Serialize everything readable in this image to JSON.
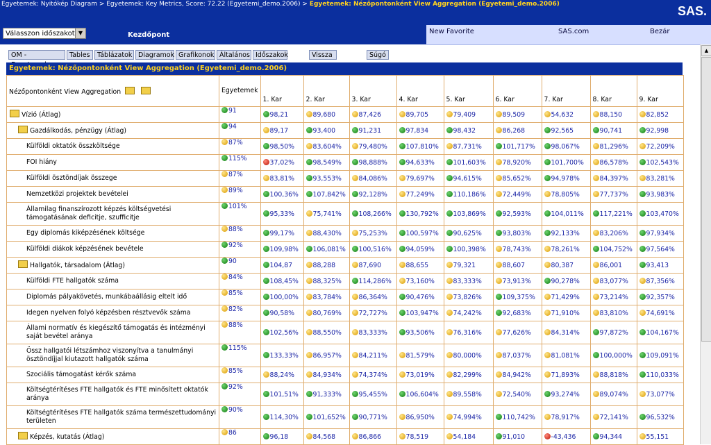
{
  "breadcrumb": {
    "items": [
      "Egyetemek: Nyitókép Diagram",
      "Egyetemek: Key Metrics, Score: 72.22 (Egyetemi_demo.2006)"
    ],
    "separator": " > ",
    "current": "Egyetemek: Nézőpontonként View Aggregation (Egyetemi_demo.2006)"
  },
  "logo": "SAS.",
  "period_select": "Válasszon időszakot",
  "start_label": "Kezdőpont",
  "nav": {
    "new_favorite": "New Favorite",
    "sas_com": "SAS.com",
    "close": "Bezár"
  },
  "tabs": [
    "OM - Egyetemek",
    "Tables",
    "Táblázatok",
    "Diagramok",
    "Grafikonok",
    "Általános",
    "Időszakok",
    "Vissza",
    "Súgó"
  ],
  "panel_title": "Egyetemek: Nézőpontonként View Aggregation (Egyetemi_demo.2006)",
  "table": {
    "corner": "Nézőpontonként View Aggregation",
    "columns": [
      "Egyetemek",
      "1. Kar",
      "2. Kar",
      "3. Kar",
      "4. Kar",
      "5. Kar",
      "6. Kar",
      "7. Kar",
      "8. Kar",
      "9. Kar"
    ],
    "rows": [
      {
        "name": "Vízió (Átlag)",
        "level": 0,
        "cells": [
          [
            "91",
            "g"
          ],
          [
            "98,21",
            "g"
          ],
          [
            "89,680",
            "y"
          ],
          [
            "87,426",
            "y"
          ],
          [
            "89,705",
            "y"
          ],
          [
            "79,409",
            "y"
          ],
          [
            "89,509",
            "y"
          ],
          [
            "54,632",
            "y"
          ],
          [
            "88,150",
            "y"
          ],
          [
            "82,852",
            "y"
          ]
        ]
      },
      {
        "name": "Gazdálkodás, pénzügy (Átlag)",
        "level": 1,
        "cells": [
          [
            "94",
            "g"
          ],
          [
            "89,17",
            "y"
          ],
          [
            "93,400",
            "g"
          ],
          [
            "91,231",
            "g"
          ],
          [
            "97,834",
            "g"
          ],
          [
            "98,432",
            "g"
          ],
          [
            "86,268",
            "y"
          ],
          [
            "92,565",
            "g"
          ],
          [
            "90,741",
            "g"
          ],
          [
            "92,998",
            "g"
          ]
        ]
      },
      {
        "name": "Külföldi oktatók összköltsége",
        "level": 2,
        "cells": [
          [
            "87%",
            "y"
          ],
          [
            "98,50%",
            "g"
          ],
          [
            "83,604%",
            "y"
          ],
          [
            "79,480%",
            "y"
          ],
          [
            "107,810%",
            "g"
          ],
          [
            "87,731%",
            "y"
          ],
          [
            "101,717%",
            "g"
          ],
          [
            "98,067%",
            "g"
          ],
          [
            "81,296%",
            "y"
          ],
          [
            "72,209%",
            "y"
          ]
        ]
      },
      {
        "name": "FOI hiány",
        "level": 2,
        "cells": [
          [
            "115%",
            "g"
          ],
          [
            "37,02%",
            "r"
          ],
          [
            "98,549%",
            "g"
          ],
          [
            "98,888%",
            "g"
          ],
          [
            "94,633%",
            "g"
          ],
          [
            "101,603%",
            "g"
          ],
          [
            "78,920%",
            "y"
          ],
          [
            "101,700%",
            "g"
          ],
          [
            "86,578%",
            "y"
          ],
          [
            "102,543%",
            "g"
          ]
        ]
      },
      {
        "name": "Külföldi ösztöndíjak összege",
        "level": 2,
        "cells": [
          [
            "87%",
            "y"
          ],
          [
            "83,81%",
            "y"
          ],
          [
            "93,553%",
            "g"
          ],
          [
            "84,086%",
            "y"
          ],
          [
            "79,697%",
            "y"
          ],
          [
            "94,615%",
            "g"
          ],
          [
            "85,652%",
            "y"
          ],
          [
            "94,978%",
            "g"
          ],
          [
            "84,397%",
            "y"
          ],
          [
            "83,281%",
            "y"
          ]
        ]
      },
      {
        "name": "Nemzetközi projektek bevételei",
        "level": 2,
        "cells": [
          [
            "89%",
            "y"
          ],
          [
            "100,36%",
            "g"
          ],
          [
            "107,842%",
            "g"
          ],
          [
            "92,128%",
            "g"
          ],
          [
            "77,249%",
            "y"
          ],
          [
            "110,186%",
            "g"
          ],
          [
            "72,449%",
            "y"
          ],
          [
            "78,805%",
            "y"
          ],
          [
            "77,737%",
            "y"
          ],
          [
            "93,983%",
            "g"
          ]
        ]
      },
      {
        "name": "Államilag finanszírozott képzés költségvetési támogatásának deficitje, szufficitje",
        "level": 2,
        "tall": true,
        "cells": [
          [
            "101%",
            "g"
          ],
          [
            "95,33%",
            "g"
          ],
          [
            "75,741%",
            "y"
          ],
          [
            "108,266%",
            "g"
          ],
          [
            "130,792%",
            "g"
          ],
          [
            "103,869%",
            "g"
          ],
          [
            "92,593%",
            "g"
          ],
          [
            "104,011%",
            "g"
          ],
          [
            "117,221%",
            "g"
          ],
          [
            "103,470%",
            "g"
          ]
        ]
      },
      {
        "name": "Egy diplomás kiképzésének költsége",
        "level": 2,
        "cells": [
          [
            "88%",
            "y"
          ],
          [
            "99,17%",
            "g"
          ],
          [
            "88,430%",
            "y"
          ],
          [
            "75,253%",
            "y"
          ],
          [
            "100,597%",
            "g"
          ],
          [
            "90,625%",
            "g"
          ],
          [
            "93,803%",
            "g"
          ],
          [
            "92,133%",
            "g"
          ],
          [
            "83,206%",
            "y"
          ],
          [
            "97,934%",
            "g"
          ]
        ]
      },
      {
        "name": "Külföldi diákok képzésének bevétele",
        "level": 2,
        "cells": [
          [
            "92%",
            "g"
          ],
          [
            "109,98%",
            "g"
          ],
          [
            "106,081%",
            "g"
          ],
          [
            "100,516%",
            "g"
          ],
          [
            "94,059%",
            "g"
          ],
          [
            "100,398%",
            "g"
          ],
          [
            "78,743%",
            "y"
          ],
          [
            "78,261%",
            "y"
          ],
          [
            "104,752%",
            "g"
          ],
          [
            "97,564%",
            "g"
          ]
        ]
      },
      {
        "name": "Hallgatók, társadalom (Átlag)",
        "level": 1,
        "cells": [
          [
            "90",
            "g"
          ],
          [
            "104,87",
            "g"
          ],
          [
            "88,288",
            "y"
          ],
          [
            "87,690",
            "y"
          ],
          [
            "88,655",
            "y"
          ],
          [
            "79,321",
            "y"
          ],
          [
            "88,607",
            "y"
          ],
          [
            "80,387",
            "y"
          ],
          [
            "86,001",
            "y"
          ],
          [
            "93,413",
            "g"
          ]
        ]
      },
      {
        "name": "Külföldi FTE hallgatók száma",
        "level": 2,
        "cells": [
          [
            "84%",
            "y"
          ],
          [
            "108,45%",
            "g"
          ],
          [
            "88,325%",
            "y"
          ],
          [
            "114,286%",
            "g"
          ],
          [
            "73,160%",
            "y"
          ],
          [
            "83,333%",
            "y"
          ],
          [
            "73,913%",
            "y"
          ],
          [
            "90,278%",
            "g"
          ],
          [
            "83,077%",
            "y"
          ],
          [
            "87,356%",
            "y"
          ]
        ]
      },
      {
        "name": "Diplomás pályakövetés, munkábaállásig eltelt idő",
        "level": 2,
        "cells": [
          [
            "85%",
            "y"
          ],
          [
            "100,00%",
            "g"
          ],
          [
            "83,784%",
            "y"
          ],
          [
            "86,364%",
            "y"
          ],
          [
            "90,476%",
            "g"
          ],
          [
            "73,826%",
            "y"
          ],
          [
            "109,375%",
            "g"
          ],
          [
            "71,429%",
            "y"
          ],
          [
            "73,214%",
            "y"
          ],
          [
            "92,357%",
            "g"
          ]
        ]
      },
      {
        "name": "Idegen nyelven folyó képzésben résztvevők száma",
        "level": 2,
        "cells": [
          [
            "82%",
            "y"
          ],
          [
            "90,58%",
            "g"
          ],
          [
            "80,769%",
            "y"
          ],
          [
            "72,727%",
            "y"
          ],
          [
            "103,947%",
            "g"
          ],
          [
            "74,242%",
            "y"
          ],
          [
            "92,683%",
            "g"
          ],
          [
            "71,910%",
            "y"
          ],
          [
            "83,810%",
            "y"
          ],
          [
            "74,691%",
            "y"
          ]
        ]
      },
      {
        "name": "Állami normatív és kiegészítő támogatás és intézményi saját bevétel aránya",
        "level": 2,
        "tall": true,
        "cells": [
          [
            "88%",
            "y"
          ],
          [
            "102,56%",
            "g"
          ],
          [
            "88,550%",
            "y"
          ],
          [
            "83,333%",
            "y"
          ],
          [
            "93,506%",
            "g"
          ],
          [
            "76,316%",
            "y"
          ],
          [
            "77,626%",
            "y"
          ],
          [
            "84,314%",
            "y"
          ],
          [
            "97,872%",
            "g"
          ],
          [
            "104,167%",
            "g"
          ]
        ]
      },
      {
        "name": "Össz hallgatói létszámhoz viszonyítva a tanulmányi ösztöndíjjal kiutazott hallgatók száma",
        "level": 2,
        "tall": true,
        "cells": [
          [
            "115%",
            "g"
          ],
          [
            "133,33%",
            "g"
          ],
          [
            "86,957%",
            "y"
          ],
          [
            "84,211%",
            "y"
          ],
          [
            "81,579%",
            "y"
          ],
          [
            "80,000%",
            "y"
          ],
          [
            "87,037%",
            "y"
          ],
          [
            "81,081%",
            "y"
          ],
          [
            "100,000%",
            "g"
          ],
          [
            "109,091%",
            "g"
          ]
        ]
      },
      {
        "name": "Szociális támogatást kérők száma",
        "level": 2,
        "cells": [
          [
            "85%",
            "y"
          ],
          [
            "88,24%",
            "y"
          ],
          [
            "84,934%",
            "y"
          ],
          [
            "74,374%",
            "y"
          ],
          [
            "73,019%",
            "y"
          ],
          [
            "82,299%",
            "y"
          ],
          [
            "84,942%",
            "y"
          ],
          [
            "71,893%",
            "y"
          ],
          [
            "88,818%",
            "y"
          ],
          [
            "110,033%",
            "g"
          ]
        ]
      },
      {
        "name": "Költségtérítéses FTE hallgatók és FTE minősített oktatók aránya",
        "level": 2,
        "tall": true,
        "cells": [
          [
            "92%",
            "g"
          ],
          [
            "101,51%",
            "g"
          ],
          [
            "91,333%",
            "g"
          ],
          [
            "95,455%",
            "g"
          ],
          [
            "106,604%",
            "g"
          ],
          [
            "89,558%",
            "y"
          ],
          [
            "72,540%",
            "y"
          ],
          [
            "93,274%",
            "g"
          ],
          [
            "89,074%",
            "y"
          ],
          [
            "73,077%",
            "y"
          ]
        ]
      },
      {
        "name": "Költségtérítéses FTE hallgatók száma természettudományi területen",
        "level": 2,
        "tall": true,
        "cells": [
          [
            "90%",
            "g"
          ],
          [
            "114,30%",
            "g"
          ],
          [
            "101,652%",
            "g"
          ],
          [
            "90,771%",
            "g"
          ],
          [
            "86,950%",
            "y"
          ],
          [
            "74,994%",
            "y"
          ],
          [
            "110,742%",
            "g"
          ],
          [
            "78,917%",
            "y"
          ],
          [
            "72,141%",
            "y"
          ],
          [
            "96,532%",
            "g"
          ]
        ]
      },
      {
        "name": "Képzés, kutatás (Átlag)",
        "level": 1,
        "cells": [
          [
            "86",
            "y"
          ],
          [
            "96,18",
            "g"
          ],
          [
            "84,568",
            "y"
          ],
          [
            "86,866",
            "y"
          ],
          [
            "78,519",
            "y"
          ],
          [
            "54,184",
            "y"
          ],
          [
            "91,010",
            "g"
          ],
          [
            "-43,436",
            "r"
          ],
          [
            "94,344",
            "g"
          ],
          [
            "55,151",
            "y"
          ]
        ]
      }
    ]
  }
}
